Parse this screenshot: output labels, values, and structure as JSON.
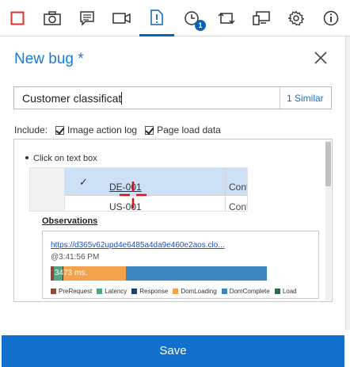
{
  "toolbar": {
    "buttons": [
      {
        "name": "stop-recording",
        "icon": "red-square-icon"
      },
      {
        "name": "screenshot",
        "icon": "camera-icon"
      },
      {
        "name": "note",
        "icon": "note-icon"
      },
      {
        "name": "video",
        "icon": "video-camera-icon"
      },
      {
        "name": "bug",
        "icon": "bug-document-icon",
        "active": true
      },
      {
        "name": "timeline",
        "icon": "clock-icon",
        "badge": "1"
      },
      {
        "name": "rotate",
        "icon": "rotate-icon"
      },
      {
        "name": "device",
        "icon": "device-icon"
      },
      {
        "name": "settings",
        "icon": "gear-icon"
      },
      {
        "name": "info",
        "icon": "info-icon"
      }
    ],
    "badge_count": "1"
  },
  "form": {
    "title": "New bug *",
    "title_value": "Customer classificat",
    "similar_label": "1 Similar",
    "include_label": "Include:",
    "image_action_log_label": "Image action log",
    "page_load_data_label": "Page load data"
  },
  "attachment": {
    "step_text": "Click on text box",
    "screenshot": {
      "row1_id": "DE-001",
      "row2_id": "US-001",
      "row1_col": "Cont",
      "row2_col": "Cont"
    },
    "observations_label": "Observations",
    "observation_link": "https://d365v62upd4e6485a4da9e460e2aos.clo...",
    "observation_time": "@3:41:56 PM",
    "bar_label": "3473 ms.",
    "segments": [
      {
        "name": "PreRequest",
        "color": "#8b4a3c",
        "fraction": 0.015
      },
      {
        "name": "Latency",
        "color": "#55a47b",
        "fraction": 0.04
      },
      {
        "name": "Response",
        "color": "#1f3e6e",
        "fraction": 0.005
      },
      {
        "name": "DomLoading",
        "color": "#f4a24b",
        "fraction": 0.29
      },
      {
        "name": "DomComplete",
        "color": "#3e86c0",
        "fraction": 0.65
      },
      {
        "name": "Load",
        "color": "#2f6a4e",
        "fraction": 0.0
      }
    ]
  },
  "footer": {
    "save_label": "Save"
  },
  "colors": {
    "accent": "#1270cc",
    "title": "#1a7ad9",
    "stop": "#e03030"
  }
}
